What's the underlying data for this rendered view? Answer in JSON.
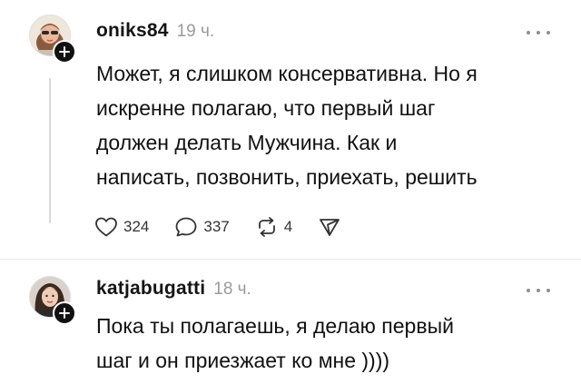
{
  "posts": [
    {
      "username": "oniks84",
      "time": "19 ч.",
      "avatar_icon": "avatar-woman-sunglasses",
      "lines": [
        "Может, я слишком консервативна. Но я",
        "искренне полагаю, что первый шаг",
        "должен делать Мужчина. Как и",
        "написать, позвонить, приехать, решить"
      ],
      "actions": {
        "likes": "324",
        "comments": "337",
        "reposts": "4"
      }
    },
    {
      "username": "katjabugatti",
      "time": "18 ч.",
      "avatar_icon": "avatar-woman-dark-hair",
      "lines": [
        "Пока ты полагаешь, я делаю первый",
        "шаг и он приезжает ко мне ))))"
      ]
    }
  ],
  "icons": {
    "follow": "plus-icon",
    "more": "more-dots-icon",
    "like": "heart-icon",
    "comment": "comment-bubble-icon",
    "repost": "repost-icon",
    "share": "send-icon"
  },
  "colors": {
    "text": "#111111",
    "muted": "#9a9a9a",
    "thread_line": "#d9d9d9"
  }
}
